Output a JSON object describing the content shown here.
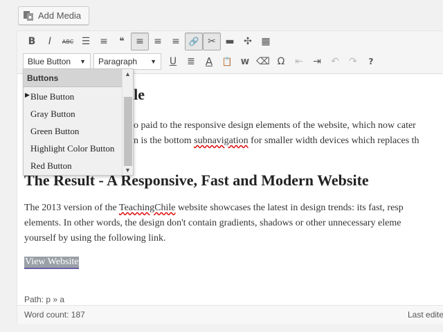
{
  "add_media": {
    "label": "Add Media"
  },
  "toolbar": {
    "row1": [
      {
        "name": "bold-icon",
        "glyph": "B"
      },
      {
        "name": "italic-icon",
        "glyph": "I"
      },
      {
        "name": "strikethrough-icon",
        "glyph": "ABC"
      },
      {
        "name": "bullet-list-icon",
        "glyph": "☰"
      },
      {
        "name": "numbered-list-icon",
        "glyph": "≡"
      },
      {
        "name": "blockquote-icon",
        "glyph": "❝"
      },
      {
        "name": "align-left-icon",
        "glyph": "≡"
      },
      {
        "name": "align-center-icon",
        "glyph": "≡"
      },
      {
        "name": "align-right-icon",
        "glyph": "≡"
      },
      {
        "name": "link-icon",
        "glyph": "🔗"
      },
      {
        "name": "unlink-icon",
        "glyph": "✂"
      },
      {
        "name": "read-more-icon",
        "glyph": "▬"
      },
      {
        "name": "fullscreen-icon",
        "glyph": "✣"
      },
      {
        "name": "toolbar-toggle-icon",
        "glyph": "▦"
      }
    ],
    "styles_select": "Blue Button",
    "format_select": "Paragraph",
    "row2": [
      {
        "name": "underline-icon",
        "glyph": "U"
      },
      {
        "name": "justify-icon",
        "glyph": "≣"
      },
      {
        "name": "text-color-icon",
        "glyph": "A"
      },
      {
        "name": "paste-text-icon",
        "glyph": "📋"
      },
      {
        "name": "paste-word-icon",
        "glyph": "W"
      },
      {
        "name": "clear-formatting-icon",
        "glyph": "⌫"
      },
      {
        "name": "special-character-icon",
        "glyph": "Ω"
      },
      {
        "name": "outdent-icon",
        "glyph": "⇤"
      },
      {
        "name": "indent-icon",
        "glyph": "⇥"
      },
      {
        "name": "undo-icon",
        "glyph": "↶"
      },
      {
        "name": "redo-icon",
        "glyph": "↷"
      },
      {
        "name": "help-icon",
        "glyph": "?"
      }
    ]
  },
  "content": {
    "heading1": "ile",
    "para1_line1": "o paid to the responsive design elements of the website, which now cater",
    "para1_line2": "n is the bottom ",
    "para1_line2_spell": "subnavigation",
    "para1_line2_end": " for smaller width devices which replaces th",
    "heading2": "The Result - A Responsive, Fast and Modern Website",
    "para2_line1_start": "The 2013 version of the ",
    "para2_line1_spell": "TeachingChile",
    "para2_line1_end": " website showcases the latest in design trends: its fast, resp",
    "para2_line2": "elements. In other words, the design don't contain gradients, shadows or other unnecessary eleme",
    "para2_line3": "yourself by using the following link.",
    "link_text": "View Website"
  },
  "path": "Path: p » a",
  "footer": {
    "word_count": "Word count: 187",
    "last_edit": "Last edite"
  },
  "dropdown": {
    "header": "Buttons",
    "items": [
      "Blue Button",
      "Gray Button",
      "Green Button",
      "Highlight Color Button",
      "Red Button"
    ],
    "selected_index": 0
  }
}
